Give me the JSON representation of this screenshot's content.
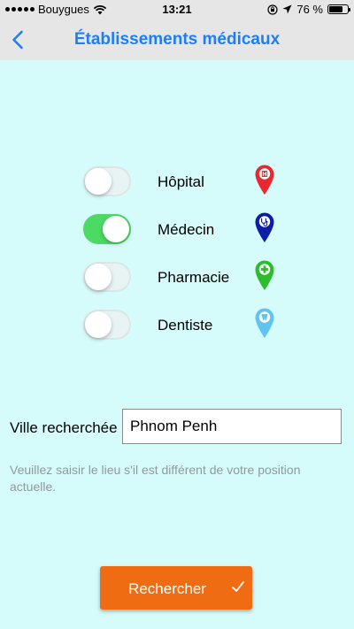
{
  "status_bar": {
    "carrier": "Bouygues",
    "time": "13:21",
    "battery": "76 %",
    "battery_level": 0.76,
    "icons": [
      "signal-dots",
      "wifi-icon",
      "rotation-lock-icon",
      "location-arrow-icon",
      "battery-icon"
    ]
  },
  "nav": {
    "title": "Établissements médicaux",
    "back_icon": "chevron-left-icon"
  },
  "colors": {
    "background": "#d6fbfb",
    "nav_title": "#1e7ef2",
    "toggle_on": "#4cd964",
    "button": "#ef6c12"
  },
  "filters": [
    {
      "label": "Hôpital",
      "enabled": false,
      "icon": "hospital-pin-icon",
      "pin_color": "#e8272e"
    },
    {
      "label": "Médecin",
      "enabled": true,
      "icon": "doctor-pin-icon",
      "pin_color": "#0c1ea6"
    },
    {
      "label": "Pharmacie",
      "enabled": false,
      "icon": "pharmacy-pin-icon",
      "pin_color": "#2bbd2b"
    },
    {
      "label": "Dentiste",
      "enabled": false,
      "icon": "dentist-pin-icon",
      "pin_color": "#63c3f0"
    }
  ],
  "city": {
    "label": "Ville recherchée",
    "value": "Phnom Penh",
    "hint": "Veuillez saisir le lieu s'il est différent de votre position actuelle."
  },
  "search_button": {
    "label": "Rechercher",
    "icon": "checkmark-icon"
  }
}
